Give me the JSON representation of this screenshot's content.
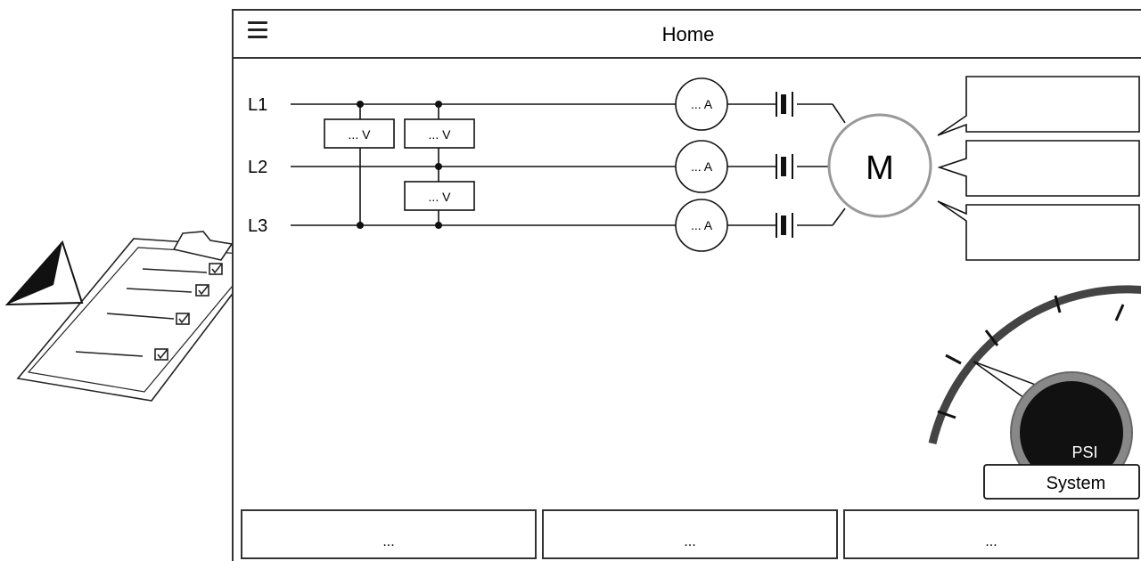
{
  "header": {
    "title": "Home",
    "menu_icon": "hamburger-menu-icon"
  },
  "circuit": {
    "lines": [
      "L1",
      "L2",
      "L3"
    ],
    "voltmeters": [
      "... V",
      "... V",
      "... V"
    ],
    "ammeters": [
      "... A",
      "... A",
      "... A"
    ],
    "motor_label": "M",
    "breaker_icon": "contact-breaker-icon"
  },
  "gauge": {
    "unit": "PSI",
    "label": "System",
    "needle_level": 0.3
  },
  "bottom_buttons": [
    "...",
    "...",
    "..."
  ],
  "decor": {
    "clipboard_icon": "checklist-clipboard-icon",
    "pen_icon": "pen-icon"
  }
}
